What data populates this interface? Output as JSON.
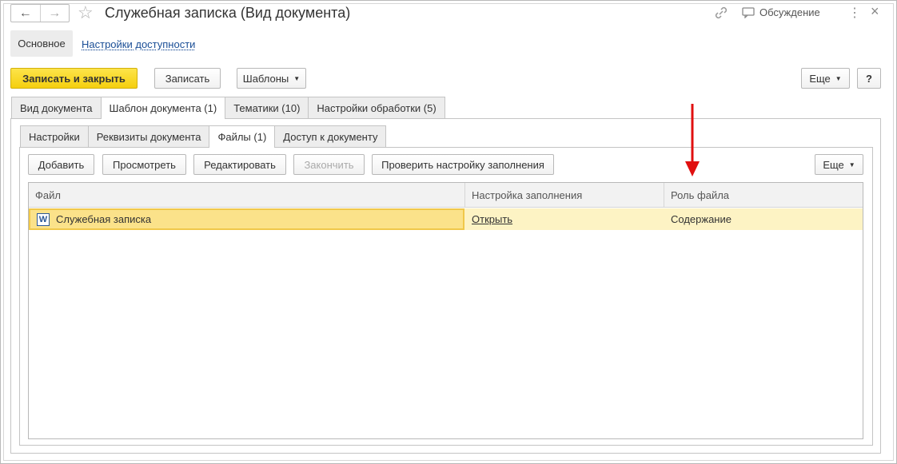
{
  "window": {
    "title": "Служебная записка (Вид документа)",
    "discussion_label": "Обсуждение"
  },
  "sections": {
    "main_label": "Основное",
    "access_settings_label": "Настройки доступности"
  },
  "toolbar": {
    "save_close_label": "Записать и закрыть",
    "save_label": "Записать",
    "templates_label": "Шаблоны",
    "more_label": "Еще",
    "help_label": "?"
  },
  "main_tabs": [
    {
      "label": "Вид документа"
    },
    {
      "label": "Шаблон документа (1)"
    },
    {
      "label": "Тематики (10)"
    },
    {
      "label": "Настройки обработки (5)"
    }
  ],
  "sub_tabs": [
    {
      "label": "Настройки"
    },
    {
      "label": "Реквизиты документа"
    },
    {
      "label": "Файлы (1)"
    },
    {
      "label": "Доступ к документу"
    }
  ],
  "files_toolbar": {
    "add_label": "Добавить",
    "view_label": "Просмотреть",
    "edit_label": "Редактировать",
    "finish_label": "Закончить",
    "check_fill_label": "Проверить настройку заполнения",
    "more_label": "Еще"
  },
  "grid": {
    "columns": [
      "Файл",
      "Настройка заполнения",
      "Роль файла"
    ],
    "rows": [
      {
        "file": "Служебная записка",
        "fill_setting": "Открыть",
        "role": "Содержание"
      }
    ]
  },
  "colors": {
    "primary_button": "#f5cf0f",
    "selected_row": "#fdf3c4",
    "link": "#1a4e96",
    "annotation_arrow": "#e01010"
  },
  "icons": {
    "back": "arrow-left-icon",
    "forward": "arrow-right-icon",
    "favorite": "star-icon",
    "link": "link-icon",
    "discussion": "chat-icon",
    "menu": "more-dots-icon",
    "close": "close-icon",
    "word": "word-file-icon"
  }
}
